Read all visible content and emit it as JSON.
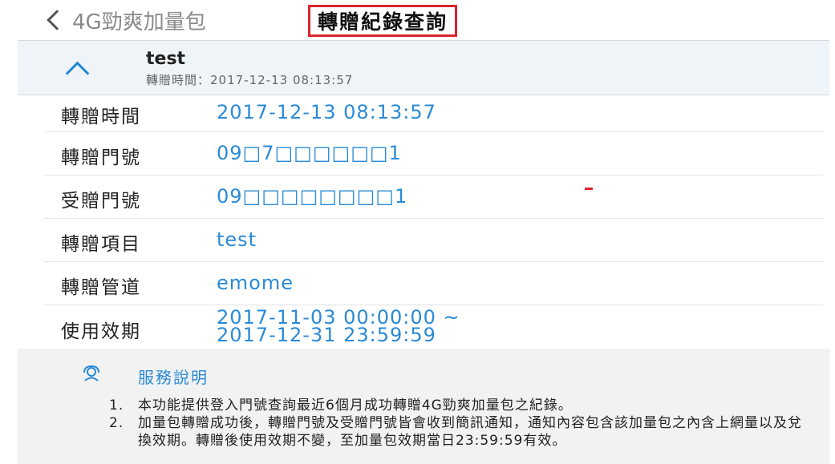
{
  "header": {
    "back_label": "4G勁爽加量包",
    "title": "轉贈紀錄查詢"
  },
  "record": {
    "name": "test",
    "time_line": "轉贈時間：2017-12-13 08:13:57"
  },
  "details": [
    {
      "label": "轉贈時間",
      "value": "2017-12-13 08:13:57"
    },
    {
      "label": "轉贈門號",
      "value": "09□7□□□□□□1"
    },
    {
      "label": "受贈門號",
      "value": "09□□□□□□□□1"
    },
    {
      "label": "轉贈項目",
      "value": "test"
    },
    {
      "label": "轉贈管道",
      "value": "emome"
    },
    {
      "label": "使用效期",
      "value_line1": "2017-11-03 00:00:00 ~",
      "value_line2": "2017-12-31 23:59:59"
    }
  ],
  "service": {
    "icon": "support-icon",
    "title": "服務說明",
    "notes": [
      {
        "num": "1.",
        "text": "本功能提供登入門號查詢最近6個月成功轉贈4G勁爽加量包之紀錄。"
      },
      {
        "num": "2.",
        "text": "加量包轉贈成功後，轉贈門號及受贈門號皆會收到簡訊通知，通知內容包含該加量包之內含上網量以及兌換效期。轉贈後使用效期不變，至加量包效期當日23:59:59有效。"
      }
    ]
  },
  "colors": {
    "accent": "#2a8ad6",
    "highlight_border": "#d9262c"
  }
}
